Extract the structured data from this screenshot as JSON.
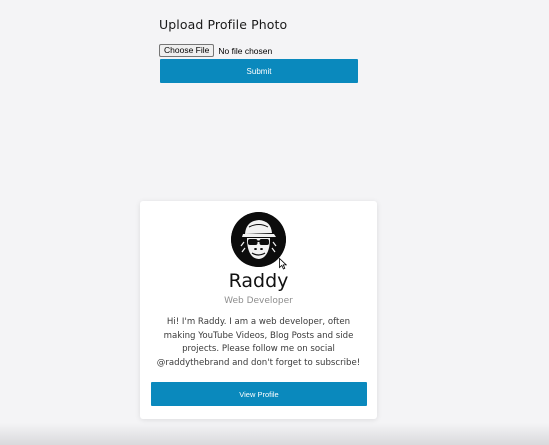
{
  "upload": {
    "title": "Upload Profile Photo",
    "choose_file_label": "Choose File",
    "file_status": "No file chosen",
    "submit_label": "Submit"
  },
  "profile": {
    "avatar_icon": "gorilla-avatar-icon",
    "name": "Raddy",
    "role": "Web Developer",
    "bio": "Hi! I'm Raddy. I am a web developer, often making YouTube Videos, Blog Posts and side projects. Please follow me on social @raddythebrand and don't forget to subscribe!",
    "view_label": "View Profile"
  },
  "colors": {
    "accent": "#0a89bd",
    "background": "#f4f4f6",
    "card": "#ffffff"
  }
}
